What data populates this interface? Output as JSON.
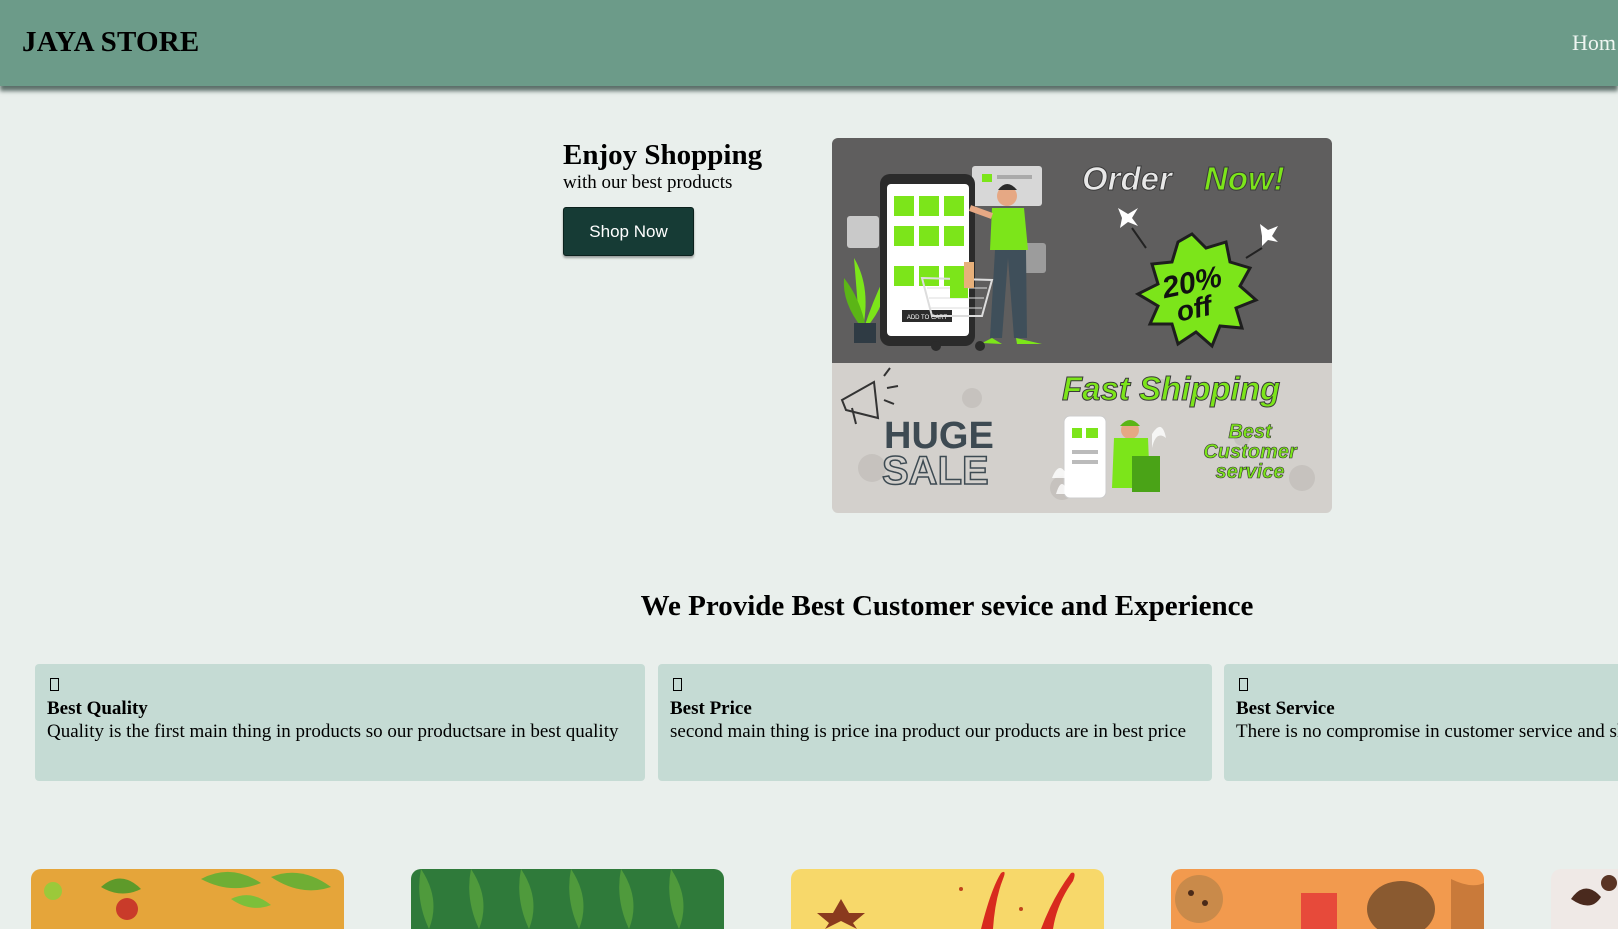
{
  "header": {
    "brand": "JAYA STORE",
    "nav_home": "Hom"
  },
  "hero": {
    "title": "Enjoy Shopping",
    "subtitle": "with our best products",
    "cta_label": "Shop Now",
    "banner": {
      "headline_left": "Order",
      "headline_right": "Now!",
      "discount_top": "20%",
      "discount_bottom": "off",
      "fast_shipping": "Fast Shipping",
      "huge": "HUGE",
      "sale": "SALE",
      "service_line1": "Best",
      "service_line2": "Customer",
      "service_line3": "service",
      "cart_button": "ADD TO CART"
    }
  },
  "features": {
    "heading": "We Provide Best Customer sevice and Experience",
    "items": [
      {
        "icon": "box-icon",
        "title": "Best Quality",
        "desc": "Quality is the first main thing in products so our productsare in best quality"
      },
      {
        "icon": "box-icon",
        "title": "Best Price",
        "desc": "second main thing is price ina product our products are in best price"
      },
      {
        "icon": "box-icon",
        "title": "Best Service",
        "desc": "There is no compromise in customer service and shop"
      }
    ]
  },
  "categories": [
    {
      "name": "fruits-card",
      "color": "#e5a53a"
    },
    {
      "name": "leaves-card",
      "color": "#2f7a3a"
    },
    {
      "name": "spices-card",
      "color": "#f7d86a"
    },
    {
      "name": "snacks-card",
      "color": "#f29a4e"
    },
    {
      "name": "chocolate-card",
      "color": "#efe9e6"
    }
  ],
  "colors": {
    "header": "#6c9b89",
    "page": "#e9efec",
    "button": "#163b35",
    "feature_card": "#c5dbd4",
    "banner_accent": "#7ce51a"
  }
}
